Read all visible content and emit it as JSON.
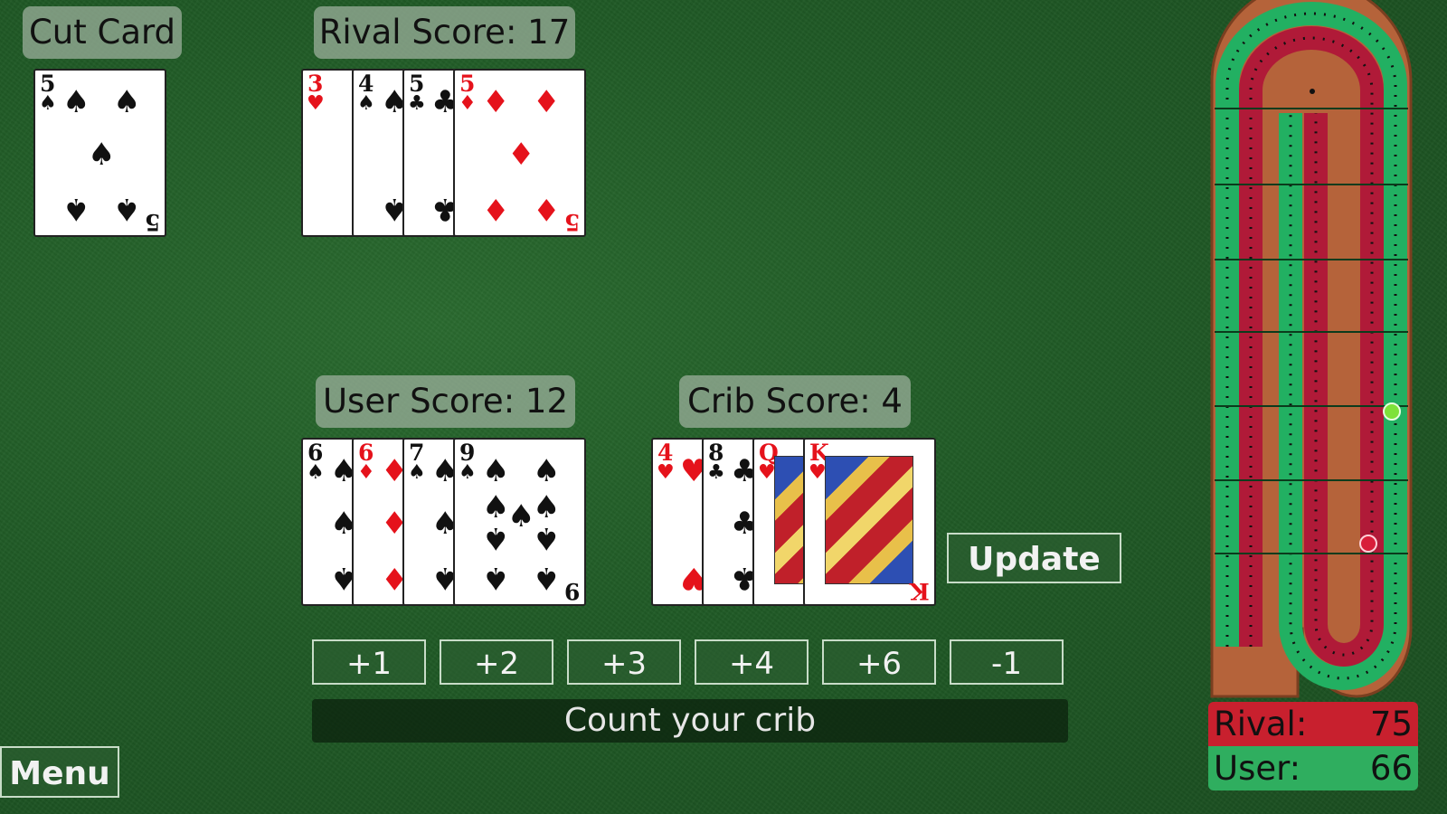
{
  "labels": {
    "cut_card": "Cut Card",
    "rival_score": "Rival Score: 17",
    "user_score": "User Score: 12",
    "crib_score": "Crib Score: 4"
  },
  "cut_card": {
    "rank": "5",
    "suit": "♠",
    "color": "black"
  },
  "rival_hand": [
    {
      "rank": "3",
      "suit": "♥",
      "color": "red"
    },
    {
      "rank": "4",
      "suit": "♠",
      "color": "black"
    },
    {
      "rank": "5",
      "suit": "♣",
      "color": "black"
    },
    {
      "rank": "5",
      "suit": "♦",
      "color": "red"
    }
  ],
  "user_hand": [
    {
      "rank": "6",
      "suit": "♠",
      "color": "black"
    },
    {
      "rank": "6",
      "suit": "♦",
      "color": "red"
    },
    {
      "rank": "7",
      "suit": "♠",
      "color": "black"
    },
    {
      "rank": "9",
      "suit": "♠",
      "color": "black"
    }
  ],
  "crib_hand": [
    {
      "rank": "4",
      "suit": "♥",
      "color": "red"
    },
    {
      "rank": "8",
      "suit": "♣",
      "color": "black"
    },
    {
      "rank": "Q",
      "suit": "♥",
      "color": "red"
    },
    {
      "rank": "K",
      "suit": "♥",
      "color": "red"
    }
  ],
  "buttons": {
    "update": "Update",
    "plus1": "+1",
    "plus2": "+2",
    "plus3": "+3",
    "plus4": "+4",
    "plus6": "+6",
    "minus1": "-1",
    "menu": "Menu"
  },
  "status": "Count your crib",
  "scoreboard": {
    "rival_label": "Rival:",
    "rival_value": "75",
    "user_label": "User:",
    "user_value": "66",
    "rival_color": "#c8202e",
    "user_color": "#2fae5f"
  },
  "board": {
    "wood_color": "#b5633a",
    "red_track": "#b01a38",
    "green_track": "#22b062",
    "rival_peg_color": "#d81e3a",
    "user_peg_color": "#7ee23a"
  }
}
